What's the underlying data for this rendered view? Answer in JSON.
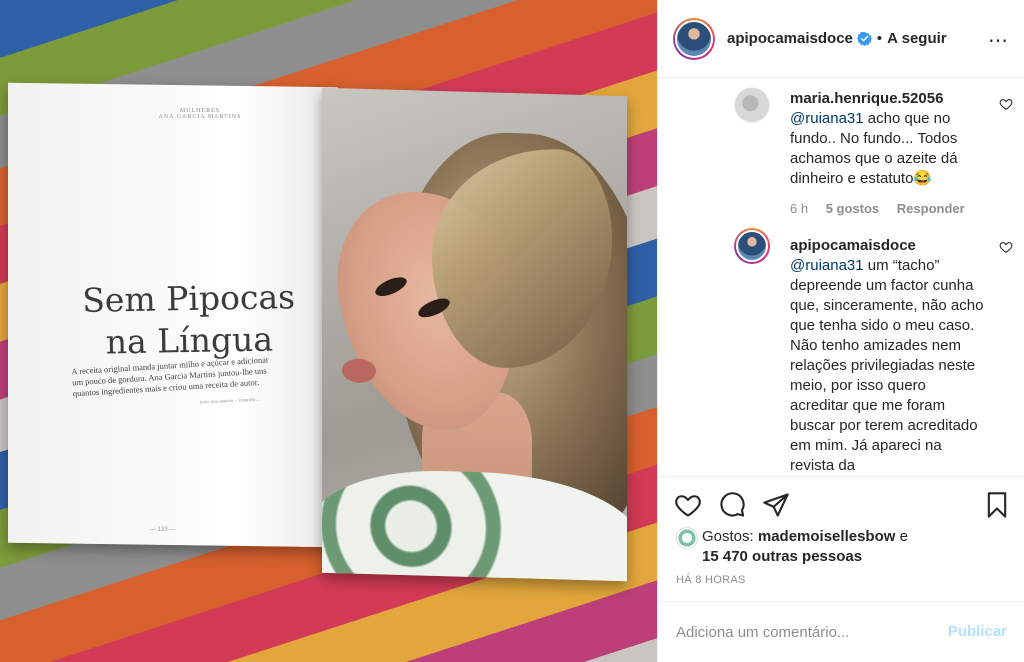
{
  "photo": {
    "magazine": {
      "header_line1": "MULHERES",
      "header_line2": "ANA GARCIA MARTINS",
      "title_line1": "Sem Pipocas",
      "title_line2": "na Língua",
      "description": "A receita original manda juntar milho e açúcar e adicionar um pouco de gordura. Ana Garcia Martins juntou-lhe uns quantos ingredientes mais e criou uma receita de autor.",
      "credit": "texto: ana.catarina ... fotografia ...",
      "page_number": "— 123 —"
    }
  },
  "post": {
    "header": {
      "username": "apipocamaisdoce",
      "follow_dot": "•",
      "follow_label": "A seguir",
      "more_icon": "⋯"
    },
    "comments": [
      {
        "username": "maria.henrique.52056",
        "mention": "@ruiana31",
        "text": " acho que no fundo.. No fundo... Todos achamos que o azeite dá dinheiro e estatuto😂",
        "time": "6 h",
        "likes": "5 gostos",
        "reply": "Responder"
      },
      {
        "username": "apipocamaisdoce",
        "mention": "@ruiana31",
        "text": " um “tacho” depreende um factor cunha que, sinceramente, não acho que tenha sido o meu caso. Não tenho amizades nem relações privilegiadas neste meio, por isso quero acreditar que me foram buscar por terem acreditado em mim. Já apareci na revista da"
      }
    ],
    "likes": {
      "prefix": "Gostos: ",
      "user": "mademoisellesbow",
      "conjunction": " e",
      "others": "15 470 outras pessoas"
    },
    "timestamp": "HÁ 8 HORAS",
    "add_comment": {
      "placeholder": "Adiciona um comentário...",
      "publish_label": "Publicar"
    },
    "colors": {
      "verified_blue": "#3897f0",
      "publish_disabled": "#b2dffc",
      "mention": "#00376b"
    },
    "icons": [
      "heart-icon",
      "comment-icon",
      "share-icon",
      "bookmark-icon",
      "verified-icon",
      "more-icon"
    ]
  }
}
